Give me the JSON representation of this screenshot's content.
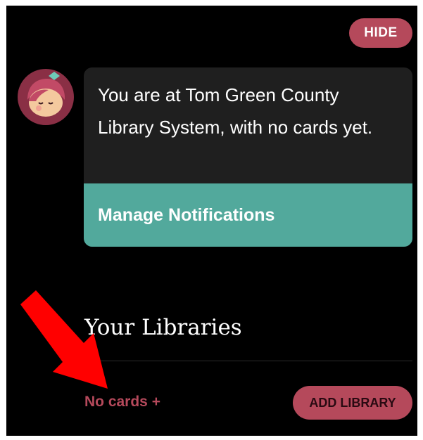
{
  "header": {
    "hide_label": "HIDE"
  },
  "notification": {
    "message": "You are at Tom Green County Library System, with no cards yet.",
    "manage_label": "Manage Notifications"
  },
  "libraries": {
    "title": "Your Libraries",
    "no_cards_label": "No cards +",
    "add_library_label": "ADD LIBRARY"
  },
  "icons": {
    "avatar": "libby-avatar-icon",
    "annotation": "red-arrow-icon"
  },
  "colors": {
    "background": "#000000",
    "accent": "#b5495b",
    "teal": "#52a99c",
    "card": "#1f1f1f",
    "annotation_arrow": "#ff0000"
  }
}
